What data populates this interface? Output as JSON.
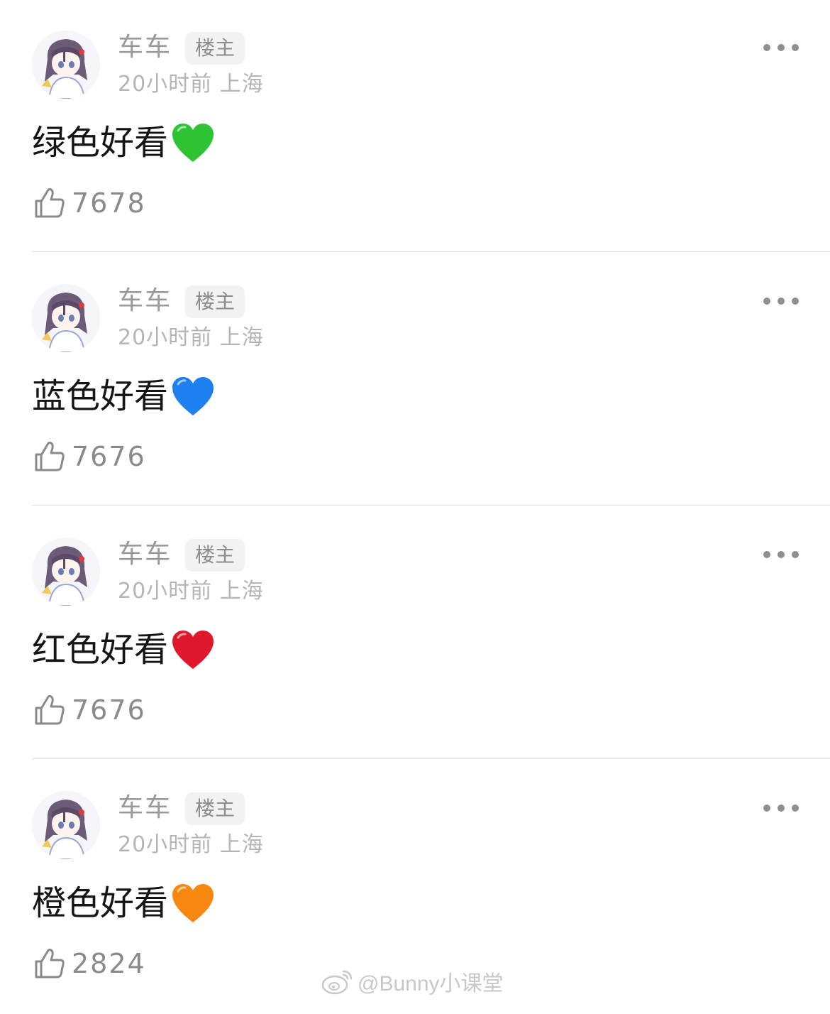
{
  "comments": [
    {
      "username": "车车",
      "badge": "楼主",
      "meta": "20小时前 上海",
      "text": "绿色好看",
      "heart_color": "#2ec332",
      "heart_icon": "green-heart-icon",
      "likes": "7678"
    },
    {
      "username": "车车",
      "badge": "楼主",
      "meta": "20小时前 上海",
      "text": "蓝色好看",
      "heart_color": "#1e7ff0",
      "heart_icon": "blue-heart-icon",
      "likes": "7676"
    },
    {
      "username": "车车",
      "badge": "楼主",
      "meta": "20小时前 上海",
      "text": "红色好看",
      "heart_color": "#e0162b",
      "heart_icon": "red-heart-icon",
      "likes": "7676"
    },
    {
      "username": "车车",
      "badge": "楼主",
      "meta": "20小时前 上海",
      "text": "橙色好看",
      "heart_color": "#f7870f",
      "heart_icon": "orange-heart-icon",
      "likes": "2824"
    }
  ],
  "watermark": {
    "icon": "weibo-icon",
    "text": "@Bunny小课堂"
  }
}
